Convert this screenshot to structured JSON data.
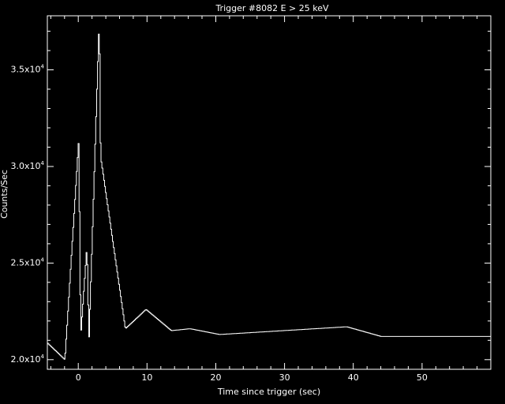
{
  "chart_data": {
    "type": "line",
    "title": "Trigger #8082 E > 25 keV",
    "xlabel": "Time since trigger (sec)",
    "ylabel": "Counts/Sec",
    "xlim": [
      -4.5,
      60
    ],
    "ylim": [
      19500,
      37800
    ],
    "x_ticks": [
      0,
      10,
      20,
      30,
      40,
      50
    ],
    "y_ticks": [
      {
        "value": 20000,
        "mantissa": "2.0x10",
        "exp": "4"
      },
      {
        "value": 25000,
        "mantissa": "2.5x10",
        "exp": "4"
      },
      {
        "value": 30000,
        "mantissa": "3.0x10",
        "exp": "4"
      },
      {
        "value": 35000,
        "mantissa": "3.5x10",
        "exp": "4"
      }
    ],
    "grid": false,
    "colors": {
      "background": "#000000",
      "foreground": "#ffffff"
    },
    "series": [
      {
        "step": 0.128,
        "x": [
          -4.5,
          -2.0,
          0.0,
          0.3,
          1.2,
          1.5,
          3.0,
          3.2,
          6.8,
          9.8,
          13.5,
          16.2,
          20.5,
          39.0,
          44.0,
          52.0
        ],
        "y": [
          20850,
          20000,
          31300,
          21200,
          25900,
          21000,
          37700,
          30500,
          21600,
          22600,
          21500,
          21600,
          21300,
          21700,
          21200,
          21200
        ]
      }
    ]
  }
}
